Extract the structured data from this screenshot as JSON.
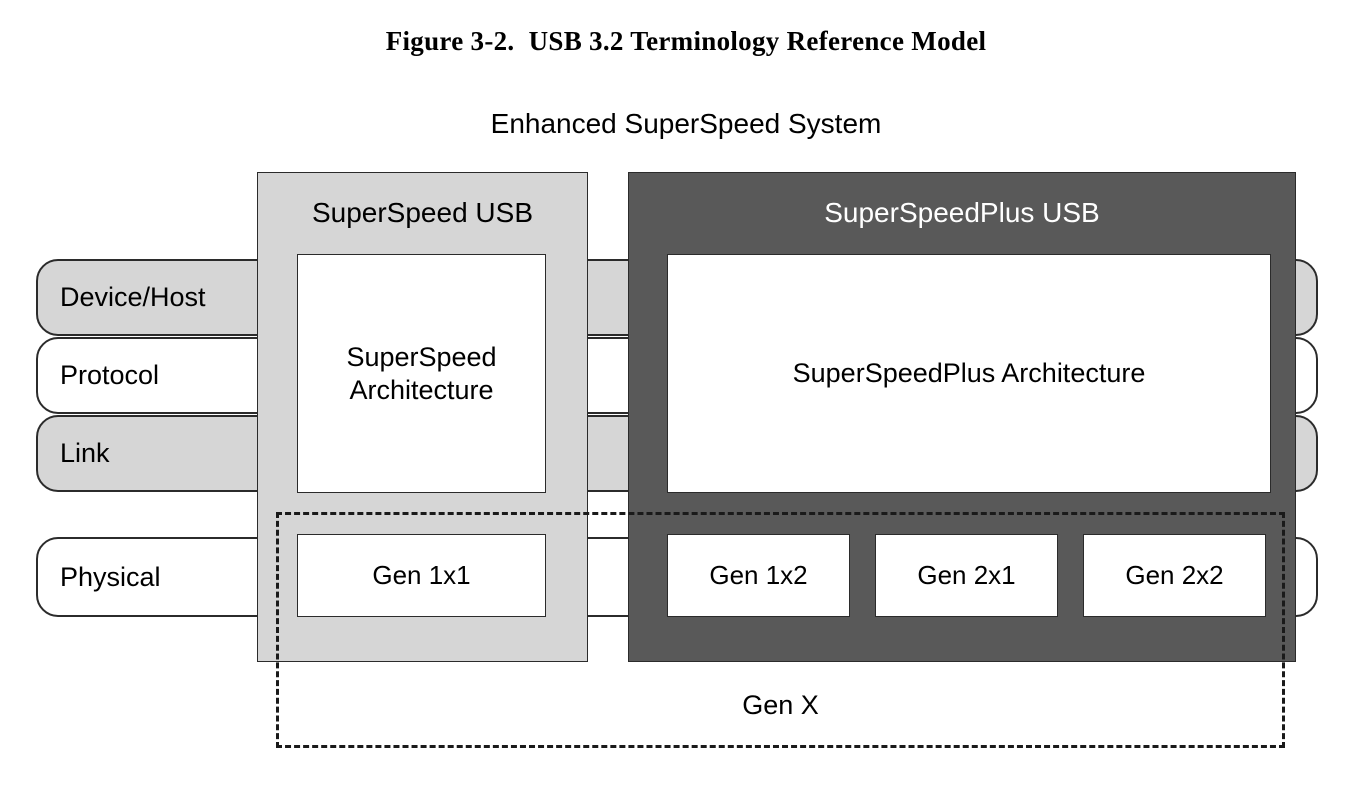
{
  "figure": {
    "title": "Figure 3-2.  USB 3.2 Terminology Reference Model",
    "subtitle": "Enhanced SuperSpeed System"
  },
  "layers": [
    {
      "label": "Device/Host",
      "fill": "#d6d6d6"
    },
    {
      "label": "Protocol",
      "fill": "#ffffff"
    },
    {
      "label": "Link",
      "fill": "#d6d6d6"
    },
    {
      "label": "Physical",
      "fill": "#ffffff"
    }
  ],
  "groups": [
    {
      "id": "superspeed",
      "title": "SuperSpeed USB",
      "fill": "#d6d6d6",
      "text_color": "#000000",
      "architecture_box": "SuperSpeed\nArchitecture",
      "gen_boxes": [
        "Gen 1x1"
      ]
    },
    {
      "id": "superspeedplus",
      "title": "SuperSpeedPlus USB",
      "fill": "#595959",
      "text_color": "#ffffff",
      "architecture_box": "SuperSpeedPlus Architecture",
      "gen_boxes": [
        "Gen 1x2",
        "Gen 2x1",
        "Gen 2x2"
      ]
    }
  ],
  "genx": {
    "label": "Gen X"
  },
  "colors": {
    "light_gray": "#d6d6d6",
    "dark_gray": "#595959",
    "outline": "#2b2b2b",
    "background": "#ffffff"
  }
}
